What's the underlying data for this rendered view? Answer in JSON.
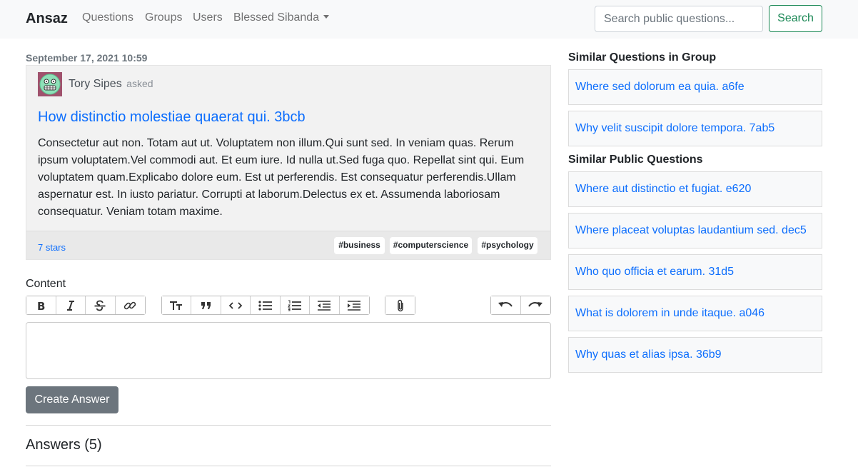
{
  "navbar": {
    "brand": "Ansaz",
    "links": [
      "Questions",
      "Groups",
      "Users"
    ],
    "user_menu": "Blessed Sibanda",
    "search_placeholder": "Search public questions...",
    "search_button": "Search"
  },
  "question": {
    "date": "September 17, 2021 10:59",
    "author": "Tory Sipes",
    "asked_label": "asked",
    "title": "How distinctio molestiae quaerat qui. 3bcb",
    "body": "Consectetur aut non. Totam aut ut. Voluptatem non illum.Qui sunt sed. In veniam quas. Rerum ipsum voluptatem.Vel commodi aut. Et eum iure. Id nulla ut.Sed fuga quo. Repellat sint qui. Eum voluptatem quam.Explicabo dolore eum. Est ut perferendis. Est consequatur perferendis.Ullam aspernatur est. In iusto pariatur. Corrupti at laborum.Delectus ex et. Assumenda laboriosam consequatur. Veniam totam maxime.",
    "stars": "7 stars",
    "tags": [
      "#business",
      "#computerscience",
      "#psychology"
    ]
  },
  "editor": {
    "label": "Content",
    "toolbar_icons": [
      "bold-icon",
      "italic-icon",
      "strikethrough-icon",
      "link-icon",
      "heading-icon",
      "quote-icon",
      "code-icon",
      "bullet-list-icon",
      "numbered-list-icon",
      "outdent-icon",
      "indent-icon",
      "attach-icon",
      "undo-icon",
      "redo-icon"
    ],
    "submit_label": "Create Answer"
  },
  "answers": {
    "heading": "Answers (5)"
  },
  "sidebar": {
    "group_heading": "Similar Questions in Group",
    "group_questions": [
      "Where sed dolorum ea quia. a6fe",
      "Why velit suscipit dolore tempora. 7ab5"
    ],
    "public_heading": "Similar Public Questions",
    "public_questions": [
      "Where aut distinctio et fugiat. e620",
      "Where placeat voluptas laudantium sed. dec5",
      "Who quo officia et earum. 31d5",
      "What is dolorem in unde itaque. a046",
      "Why quas et alias ipsa. 36b9"
    ]
  },
  "colors": {
    "link": "#0d6efd",
    "success": "#198754",
    "secondary": "#6c757d",
    "navbar_bg": "#f8f9fa"
  }
}
